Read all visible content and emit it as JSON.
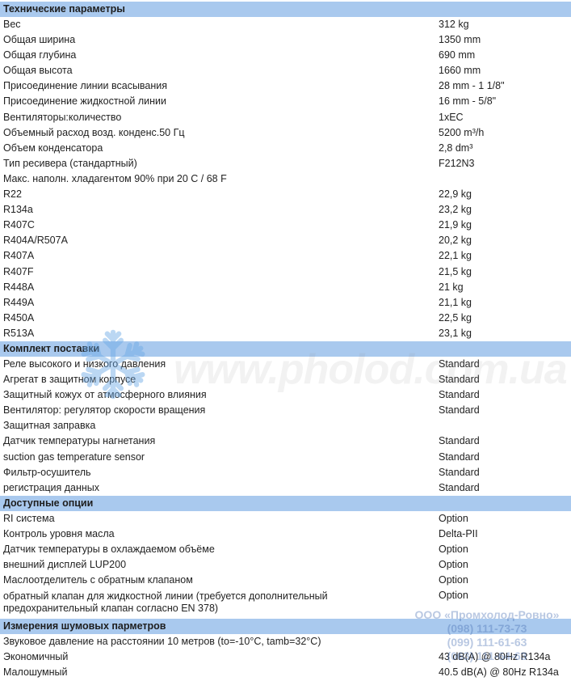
{
  "sections": [
    {
      "title": "Технические параметры",
      "rows": [
        {
          "label": "Вес",
          "value": "312 kg"
        },
        {
          "label": "Общая ширина",
          "value": "1350 mm"
        },
        {
          "label": "Общая глубина",
          "value": "690 mm"
        },
        {
          "label": "Общая высота",
          "value": "1660 mm"
        },
        {
          "label": "Присоединение линии всасывания",
          "value": "28 mm - 1 1/8\""
        },
        {
          "label": "Присоединение жидкостной линии",
          "value": "16 mm - 5/8\""
        },
        {
          "label": "Вентиляторы:количество",
          "value": "1xEC"
        },
        {
          "label": "Объемный расход возд. конденс.50 Гц",
          "value": "5200 m³/h"
        },
        {
          "label": "Объем конденсатора",
          "value": "2,8 dm³"
        },
        {
          "label": "Тип ресивера (стандартный)",
          "value": "F212N3"
        },
        {
          "label": "Макс. наполн. хладагентом 90% при 20 C / 68 F",
          "value": ""
        },
        {
          "label": "R22",
          "value": "22,9 kg"
        },
        {
          "label": "R134a",
          "value": "23,2 kg"
        },
        {
          "label": "R407C",
          "value": "21,9 kg"
        },
        {
          "label": "R404A/R507A",
          "value": "20,2 kg"
        },
        {
          "label": "R407A",
          "value": "22,1 kg"
        },
        {
          "label": "R407F",
          "value": "21,5 kg"
        },
        {
          "label": "R448A",
          "value": "21 kg"
        },
        {
          "label": "R449A",
          "value": "21,1 kg"
        },
        {
          "label": "R450A",
          "value": "22,5 kg"
        },
        {
          "label": "R513A",
          "value": "23,1 kg"
        }
      ]
    },
    {
      "title": "Комплект поставки",
      "rows": [
        {
          "label": "Реле высокого и низкого давления",
          "value": "Standard"
        },
        {
          "label": "Агрегат в защитном корпусе",
          "value": "Standard"
        },
        {
          "label": "Защитный кожух от атмосферного влияния",
          "value": "Standard"
        },
        {
          "label": "Вентилятор: регулятор скорости вращения",
          "value": "Standard"
        },
        {
          "label": "Защитная заправка",
          "value": ""
        },
        {
          "label": "Датчик температуры нагнетания",
          "value": "Standard"
        },
        {
          "label": "suction gas temperature sensor",
          "value": "Standard"
        },
        {
          "label": "Фильтр-осушитель",
          "value": "Standard"
        },
        {
          "label": "регистрация данных",
          "value": "Standard"
        }
      ]
    },
    {
      "title": "Доступные опции",
      "rows": [
        {
          "label": "RI система",
          "value": "Option"
        },
        {
          "label": "Контроль уровня масла",
          "value": "Delta-PII"
        },
        {
          "label": "Датчик температуры в охлаждаемом объёме",
          "value": "Option"
        },
        {
          "label": "внешний дисплей LUP200",
          "value": "Option"
        },
        {
          "label": "Маслоотделитель с обратным клапаном",
          "value": "Option"
        },
        {
          "label": "обратный клапан для жидкостной линии (требуется дополнительный предохранительный клапан согласно EN 378)",
          "value": "Option",
          "tall": true
        }
      ]
    },
    {
      "title": "Измерения шумовых парметров",
      "rows": [
        {
          "label": "Звуковое давление на расстоянии 10 метров (to=-10°C, tamb=32°C)",
          "value": ""
        },
        {
          "label": "Экономичный",
          "value": "43 dB(A) @ 80Hz R134a"
        },
        {
          "label": "Малошумный",
          "value": "40.5 dB(A) @ 80Hz R134a"
        }
      ]
    }
  ],
  "watermark": {
    "site": "www.pholod.com.ua",
    "company": "ООО «Промхолод-Ровно»",
    "phones": [
      "(098) 111-73-73",
      "(099) 111-61-63",
      "(063) 111-64-63"
    ]
  },
  "colors": {
    "section_header_bg": "#a9c9ee"
  }
}
